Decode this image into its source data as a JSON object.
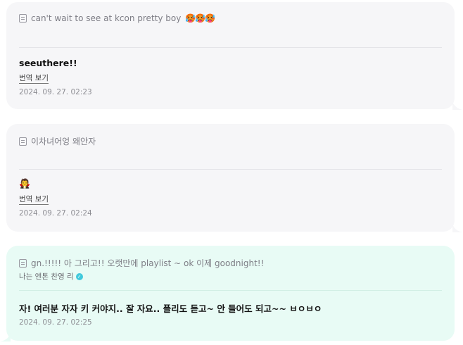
{
  "messages": [
    {
      "quote_text": "can't wait to see at kcon pretty boy",
      "quote_emoji": "🥵🥵🥵",
      "body": "seeuthere!!",
      "translate_label": "번역 보기",
      "timestamp": "2024. 09. 27. 02:23"
    },
    {
      "quote_text": "이차녀어엉 왜안자",
      "body": "🧛",
      "translate_label": "번역 보기",
      "timestamp": "2024. 09. 27. 02:24"
    },
    {
      "quote_text": "gn.!!!!! 아 그리고!! 오랫만에 playlist ~ ok 이제 goodnight!!",
      "sender": "나는 앤톤 찬영 리",
      "body": "자! 여러분 자자 키 커야지.. 잘 자요.. 플리도 듣고~ 안 들어도 되고~~ ㅂㅇㅂㅇ",
      "timestamp": "2024. 09. 27. 02:25"
    }
  ],
  "icons": {
    "quote": "quote-document-icon",
    "verified": "verified-check-icon"
  },
  "colors": {
    "card_gray": "#f6f6f8",
    "card_mint": "#e8fbf5",
    "verified": "#40c9dc"
  }
}
